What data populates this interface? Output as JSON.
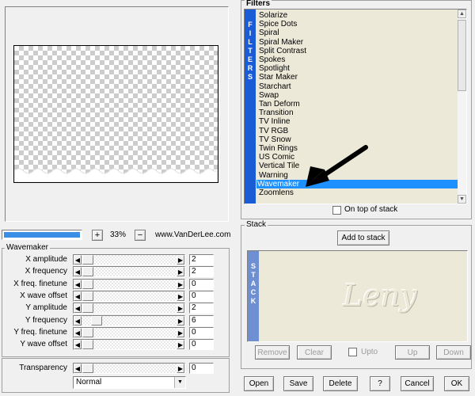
{
  "preview": {
    "zoom": "33%",
    "zoom_in": "+",
    "zoom_out": "−",
    "credit": "www.VanDerLee.com",
    "progress_percent": 100
  },
  "wavemaker": {
    "group_title": "Wavemaker",
    "params": [
      {
        "label": "X amplitude",
        "value": "2"
      },
      {
        "label": "X frequency",
        "value": "2"
      },
      {
        "label": "X freq. finetune",
        "value": "0"
      },
      {
        "label": "X wave offset",
        "value": "0"
      },
      {
        "label": "Y amplitude",
        "value": "2"
      },
      {
        "label": "Y frequency",
        "value": "6"
      },
      {
        "label": "Y freq. finetune",
        "value": "0"
      },
      {
        "label": "Y wave offset",
        "value": "0"
      }
    ],
    "transparency_label": "Transparency",
    "transparency_value": "0",
    "blend_mode": "Normal"
  },
  "filters": {
    "group_title": "Filters",
    "side_label": [
      "F",
      "I",
      "L",
      "T",
      "E",
      "R",
      "S"
    ],
    "items": [
      "Solarize",
      "Spice Dots",
      "Spiral",
      "Spiral Maker",
      "Split Contrast",
      "Spokes",
      "Spotlight",
      "Star Maker",
      "Starchart",
      "Swap",
      "Tan Deform",
      "Transition",
      "TV Inline",
      "TV RGB",
      "TV Snow",
      "Twin Rings",
      "US Comic",
      "Vertical Tile",
      "Warning",
      "Wavemaker",
      "Zoomlens"
    ],
    "selected": "Wavemaker",
    "on_top_of_stack": "On top of stack"
  },
  "stack": {
    "group_title": "Stack",
    "add_button": "Add to stack",
    "side_label": [
      "S",
      "T",
      "A",
      "C",
      "K"
    ],
    "watermark": "Leny",
    "remove": "Remove",
    "clear": "Clear",
    "upto": "Upto",
    "up": "Up",
    "down": "Down"
  },
  "footer": {
    "open": "Open",
    "save": "Save",
    "delete": "Delete",
    "help": "?",
    "cancel": "Cancel",
    "ok": "OK"
  },
  "colors": {
    "accent": "#1e90ff",
    "side_bar": "#1a5bd6",
    "list_bg": "#ece9d8"
  }
}
